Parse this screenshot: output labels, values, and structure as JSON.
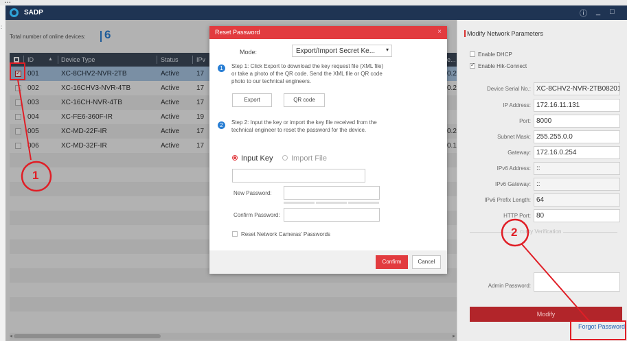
{
  "app": {
    "title": "SADP",
    "top_strip_text": "...",
    "left_edge_text": ":",
    "window_buttons": [
      "ⓘ",
      "_",
      "□"
    ]
  },
  "devices": {
    "count_label": "Total number of online devices:",
    "count": "6",
    "columns": [
      "ID",
      "Device Type",
      "Status",
      "IPv",
      "e..."
    ],
    "rows": [
      {
        "id": "001",
        "type": "XC-8CHV2-NVR-2TB",
        "status": "Active",
        "ip": "17",
        "tail": "0.2",
        "checked": true
      },
      {
        "id": "002",
        "type": "XC-16CHV3-NVR-4TB",
        "status": "Active",
        "ip": "17",
        "tail": "0.2",
        "checked": false
      },
      {
        "id": "003",
        "type": "XC-16CH-NVR-4TB",
        "status": "Active",
        "ip": "17",
        "tail": "",
        "checked": false
      },
      {
        "id": "004",
        "type": "XC-FE6-360F-IR",
        "status": "Active",
        "ip": "19",
        "tail": "",
        "checked": false
      },
      {
        "id": "005",
        "type": "XC-MD-22F-IR",
        "status": "Active",
        "ip": "17",
        "tail": "0.2",
        "checked": false
      },
      {
        "id": "006",
        "type": "XC-MD-32F-IR",
        "status": "Active",
        "ip": "17",
        "tail": "0.1",
        "checked": false
      }
    ]
  },
  "dialog": {
    "title": "Reset Password",
    "close": "×",
    "mode_label": "Mode:",
    "mode_value": "Export/Import Secret Ke...",
    "step1_no": "1",
    "step1_text": "Step 1: Click Export to download the key request file (XML file) or take a photo of the QR code. Send the XML file or QR code photo to our technical engineers.",
    "export_label": "Export",
    "qr_label": "QR code",
    "step2_no": "2",
    "step2_text": "Step 2: Input the key or import the key file received from the technical engineer to reset the password for the device.",
    "input_key_label": "Input Key",
    "import_file_label": "Import File",
    "new_password_label": "New Password:",
    "confirm_password_label": "Confirm Password:",
    "reset_cameras_label": "Reset Network Cameras' Passwords",
    "confirm_label": "Confirm",
    "cancel_label": "Cancel"
  },
  "network": {
    "title": "Modify Network Parameters",
    "enable_dhcp": "Enable DHCP",
    "enable_hik": "Enable Hik-Connect",
    "fields": [
      {
        "label": "Device Serial No.:",
        "value": "XC-8CHV2-NVR-2TB082015"
      },
      {
        "label": "IP Address:",
        "value": "172.16.11.131"
      },
      {
        "label": "Port:",
        "value": "8000"
      },
      {
        "label": "Subnet Mask:",
        "value": "255.255.0.0"
      },
      {
        "label": "Gateway:",
        "value": "172.16.0.254"
      },
      {
        "label": "IPv6 Address:",
        "value": "::"
      },
      {
        "label": "IPv6 Gateway:",
        "value": "::"
      },
      {
        "label": "IPv6 Prefix Length:",
        "value": "64"
      },
      {
        "label": "HTTP Port:",
        "value": "80"
      }
    ],
    "security_label": "curity Verification",
    "admin_password_label": "Admin Password:",
    "modify_label": "Modify",
    "forgot_label": "Forgot Password"
  },
  "annotations": {
    "one": "1",
    "two": "2",
    "color": "#e01e26"
  }
}
